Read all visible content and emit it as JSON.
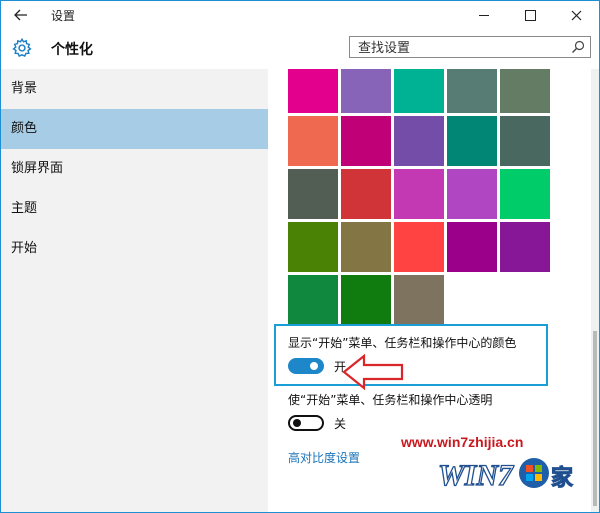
{
  "window": {
    "title": "设置",
    "back_icon": "arrow-left-icon",
    "controls": [
      "minimize-icon",
      "maximize-icon",
      "close-icon"
    ]
  },
  "header": {
    "title": "个性化",
    "icon": "gear-icon",
    "search": {
      "placeholder": "查找设置",
      "icon": "search-icon"
    }
  },
  "sidebar": {
    "items": [
      {
        "label": "背景",
        "selected": false
      },
      {
        "label": "颜色",
        "selected": true
      },
      {
        "label": "锁屏界面",
        "selected": false
      },
      {
        "label": "主题",
        "selected": false
      },
      {
        "label": "开始",
        "selected": false
      }
    ],
    "selected_color": "#a7cde6"
  },
  "swatches": {
    "rows": [
      [
        "#e3008c",
        "#8764b8",
        "#00b294",
        "#567c73",
        "#647c64"
      ],
      [
        "#ef6950",
        "#bf0077",
        "#744da9",
        "#018574",
        "#486860"
      ],
      [
        "#525e54",
        "#d13438",
        "#c239b3",
        "#b146c2",
        "#00cc6a"
      ],
      [
        "#498205",
        "#847545",
        "#ff4343",
        "#9a0089",
        "#881798"
      ],
      [
        "#10893e",
        "#107c10",
        "#7e735f"
      ]
    ]
  },
  "settings": {
    "show_color": {
      "label": "显示“开始”菜单、任务栏和操作中心的颜色",
      "state_label": "开",
      "on": true
    },
    "transparent": {
      "label": "使“开始”菜单、任务栏和操作中心透明",
      "state_label": "关",
      "on": false
    },
    "high_contrast_link": "高对比度设置"
  },
  "annotation": {
    "arrow_color": "#d9262b",
    "box_color": "#1a9ed6"
  },
  "watermark": {
    "url": "www.win7zhijia.cn",
    "logo_text": "WIN7之家"
  }
}
